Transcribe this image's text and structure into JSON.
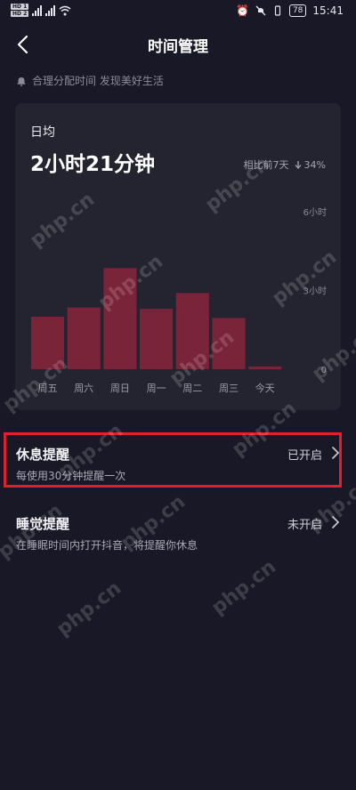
{
  "status_bar": {
    "hd_top": "HD 1",
    "hd_bottom": "HD 2",
    "left_indicators": "⁴⁶ ⁴⁶",
    "battery": "78",
    "time": "15:41"
  },
  "header": {
    "title": "时间管理"
  },
  "tip": {
    "text": "合理分配时间 发现美好生活"
  },
  "summary": {
    "label": "日均",
    "value": "2小时21分钟",
    "compare_label": "相比前7天",
    "compare_pct": "34%",
    "compare_direction": "down"
  },
  "chart_data": {
    "type": "bar",
    "categories": [
      "周五",
      "周六",
      "周日",
      "周一",
      "周二",
      "周三",
      "今天"
    ],
    "values": [
      2.0,
      2.35,
      3.85,
      2.3,
      2.9,
      1.95,
      0.1
    ],
    "unit": "hours",
    "ylim": [
      0,
      6
    ],
    "yticks": [
      {
        "value": 6,
        "label": "6小时"
      },
      {
        "value": 3,
        "label": "3小时"
      },
      {
        "value": 0,
        "label": "0"
      }
    ],
    "bar_color": "#7a2439",
    "grid": false
  },
  "reminders": [
    {
      "title": "休息提醒",
      "subtitle": "每使用30分钟提醒一次",
      "status": "已开启"
    },
    {
      "title": "睡觉提醒",
      "subtitle": "在睡眠时间内打开抖音，将提醒你休息",
      "status": "未开启"
    }
  ],
  "watermark": "php.cn",
  "colors": {
    "background": "#181826",
    "card": "#242430",
    "highlight": "#e0202c"
  }
}
